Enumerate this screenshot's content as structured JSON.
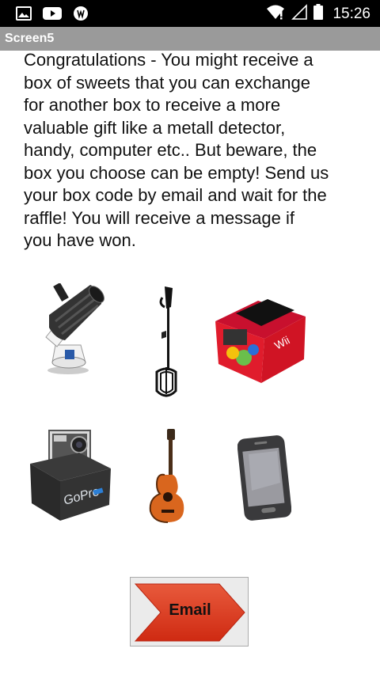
{
  "status_bar": {
    "time": "15:26",
    "left_icons": [
      "image-icon",
      "youtube-icon",
      "app-icon"
    ],
    "right_icons": [
      "wifi-icon",
      "signal-icon",
      "battery-icon"
    ]
  },
  "title_bar": {
    "title": "Screen5"
  },
  "message": "Congratulations - You might receive a\nbox of sweets that you can exchange\nfor another box to receive a more\nvaluable gift like a metall detector,\nhandy, computer etc.. But beware, the\nbox you choose can be empty! Send us\nyour box code by email and wait for the\nraffle! You will receive a message if\nyou have won.",
  "products": [
    {
      "name": "telescope"
    },
    {
      "name": "metal-detector"
    },
    {
      "name": "wii-console-box"
    },
    {
      "name": "gopro-camera"
    },
    {
      "name": "guitar"
    },
    {
      "name": "smartphone"
    }
  ],
  "email_button": {
    "label": "Email",
    "color": "#e33a20"
  }
}
